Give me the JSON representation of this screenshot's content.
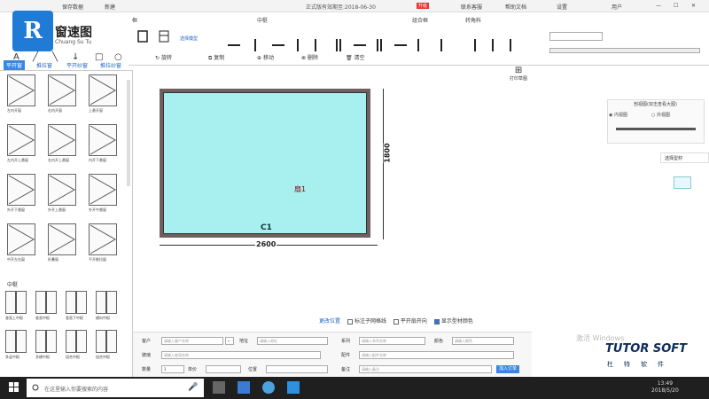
{
  "titlebar": {
    "menu_save": "保存数据",
    "menu_new": "新建",
    "title": "正式版有效期至:2018-06-30",
    "badge": "升级",
    "contact": "联系客服",
    "help": "帮助文档",
    "settings": "设置",
    "user": "用户"
  },
  "brand": {
    "name": "窗速图",
    "sub": "Chuang Su Tu",
    "logo": "R"
  },
  "ribbon": {
    "groups": [
      "框",
      "中梃",
      "组合框",
      "转角料"
    ],
    "draw_tools": [
      "A",
      "╱",
      "╲",
      "↓",
      "□",
      "○"
    ],
    "actions": [
      "旋转",
      "复制",
      "移动",
      "删除",
      "清空"
    ],
    "select_label": "选择模型",
    "print_label": "打印草图"
  },
  "left_tabs": [
    "平开窗",
    "推拉窗",
    "平开纱窗",
    "推拉纱窗"
  ],
  "thumbnails": [
    "左内开窗",
    "右内开窗",
    "上悬开窗",
    "左内开上悬窗",
    "右内开上悬窗",
    "内开下悬窗",
    "外开下悬窗",
    "外开上悬窗",
    "外开中悬窗",
    "中开左右窗",
    "折叠窗",
    "平开推拉窗"
  ],
  "section_label": "中梃",
  "mullions": [
    "垂直上中梃",
    "垂直中梃",
    "垂直下中梃",
    "横向中梃",
    "多竖中梃",
    "多横中梃",
    "组合中梃",
    "组合中梃"
  ],
  "canvas": {
    "window_label": "扇1",
    "frame_label": "C1",
    "width_dim": "2600",
    "height_dim": "1800"
  },
  "right_panel": {
    "title": "剖视图(双击查看大图)",
    "radio_in": "内视图",
    "radio_out": "外视图",
    "section": "选择型材"
  },
  "options": {
    "main": "更改位置",
    "opt1": "标注子网格线",
    "opt2": "平开扇开向",
    "opt3": "显示型材颜色"
  },
  "form": {
    "customer_lbl": "客户",
    "customer_ph": "请输入客户名称",
    "address_lbl": "地址",
    "address_ph": "请输入地址",
    "series_lbl": "系列",
    "series_ph": "请输入系列名称",
    "color_lbl": "颜色",
    "color_ph": "请输入颜色",
    "glass_lbl": "玻璃",
    "glass_ph": "请输入玻璃名称",
    "config_lbl": "配件",
    "config_ph": "请输入配件名称",
    "qty_lbl": "数量",
    "qty_val": "1",
    "unit_lbl": "单价",
    "pos_lbl": "位置",
    "note_lbl": "备注",
    "note_ph": "请输入备注",
    "submit": "加入订单"
  },
  "watermark": "激活 Windows",
  "tutor": {
    "brand": "TUTOR SOFT",
    "sub": "杜特软件"
  },
  "taskbar": {
    "search_placeholder": "在这里输入你要搜索的内容",
    "time": "13:49",
    "date": "2018/5/20"
  }
}
